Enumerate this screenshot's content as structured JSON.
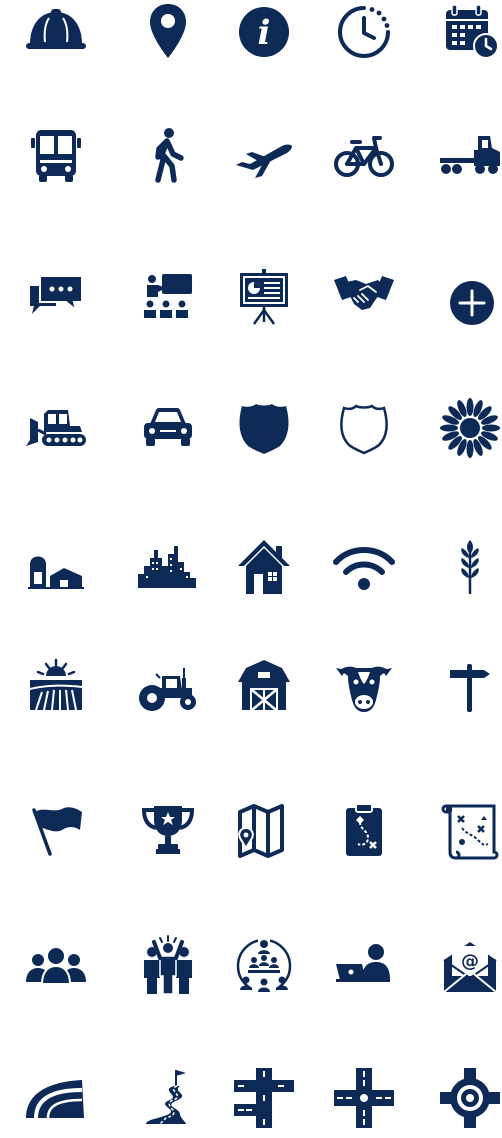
{
  "color": "#0d2a57",
  "rows": [
    [
      "hard-hat-icon",
      "map-pin-icon",
      "info-icon",
      "clock-icon",
      "calendar-clock-icon"
    ],
    [
      "bus-icon",
      "pedestrian-icon",
      "airplane-icon",
      "bicycle-icon",
      "semi-truck-icon"
    ],
    [
      "chat-bubbles-icon",
      "classroom-icon",
      "presentation-board-icon",
      "handshake-icon",
      "plus-circle-icon"
    ],
    [
      "bulldozer-icon",
      "car-icon",
      "highway-shield-filled-icon",
      "highway-shield-outline-icon",
      "sunflower-icon"
    ],
    [
      "farm-silo-icon",
      "city-skyline-icon",
      "house-icon",
      "wifi-icon",
      "wheat-icon"
    ],
    [
      "sunrise-field-icon",
      "tractor-icon",
      "barn-icon",
      "cow-icon",
      "signpost-icon"
    ],
    [
      "flag-icon",
      "trophy-icon",
      "folded-map-icon",
      "clipboard-route-icon",
      "treasure-map-icon"
    ],
    [
      "group-icon",
      "team-celebration-icon",
      "meeting-circle-icon",
      "remote-worker-icon",
      "email-envelope-icon"
    ],
    [
      "curved-road-icon",
      "winding-road-flag-icon",
      "road-junction-icon",
      "crossroads-icon",
      "roundabout-icon"
    ]
  ]
}
